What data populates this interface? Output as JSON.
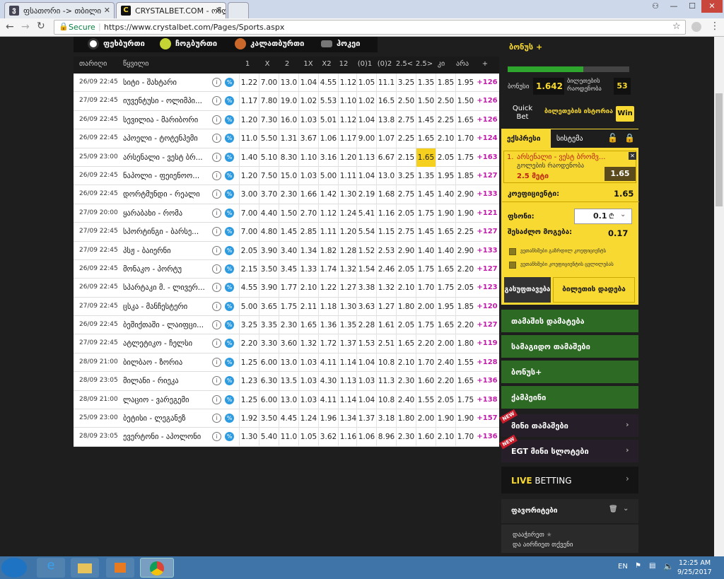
{
  "browser": {
    "tabs": [
      {
        "icon_text": "ვ",
        "label": "ფსათორი -> თბილი"
      },
      {
        "icon_text": "C",
        "label": "CRYSTALBET.COM - ონლ"
      }
    ],
    "secure_label": "Secure",
    "url": "https://www.crystalbet.com/Pages/Sports.aspx"
  },
  "sport_nav": [
    "ფეხბურთი",
    "ჩოგბურთი",
    "კალათბურთი",
    "ჰოკეი"
  ],
  "table": {
    "headers": [
      "თარიღი",
      "წყვილი",
      "1",
      "X",
      "2",
      "1X",
      "X2",
      "12",
      "(0)1",
      "(0)2",
      "2.5<",
      "2.5>",
      "კი",
      "არა",
      "+"
    ],
    "info_glyph": "i",
    "pct_glyph": "%",
    "rows": [
      {
        "date": "26/09 22:45",
        "teams": "სიტი - შახტარი",
        "odds": [
          "1.22",
          "7.00",
          "13.0",
          "1.04",
          "4.55",
          "1.12",
          "1.05",
          "11.1",
          "3.25",
          "1.35",
          "1.85",
          "1.95"
        ],
        "more": "+126"
      },
      {
        "date": "27/09 22:45",
        "teams": "იუვენტუსი - ოლიმპი...",
        "odds": [
          "1.17",
          "7.80",
          "19.0",
          "1.02",
          "5.53",
          "1.10",
          "1.02",
          "16.5",
          "2.50",
          "1.50",
          "2.50",
          "1.50"
        ],
        "more": "+126"
      },
      {
        "date": "26/09 22:45",
        "teams": "სევილია - მარიბორი",
        "odds": [
          "1.20",
          "7.30",
          "16.0",
          "1.03",
          "5.01",
          "1.12",
          "1.04",
          "13.8",
          "2.75",
          "1.45",
          "2.25",
          "1.65"
        ],
        "more": "+126"
      },
      {
        "date": "26/09 22:45",
        "teams": "აპოელი - ტოტენჰემი",
        "odds": [
          "11.0",
          "5.50",
          "1.31",
          "3.67",
          "1.06",
          "1.17",
          "9.00",
          "1.07",
          "2.25",
          "1.65",
          "2.10",
          "1.70"
        ],
        "more": "+124"
      },
      {
        "date": "25/09 23:00",
        "teams": "არსენალი - ვესტ ბრ...",
        "odds": [
          "1.40",
          "5.10",
          "8.30",
          "1.10",
          "3.16",
          "1.20",
          "1.13",
          "6.67",
          "2.15",
          "1.65",
          "2.05",
          "1.75"
        ],
        "more": "+163",
        "highlight": 9
      },
      {
        "date": "26/09 22:45",
        "teams": "ნაპოლი - ფეიენოო...",
        "odds": [
          "1.20",
          "7.50",
          "15.0",
          "1.03",
          "5.00",
          "1.11",
          "1.04",
          "13.0",
          "3.25",
          "1.35",
          "1.95",
          "1.85"
        ],
        "more": "+127"
      },
      {
        "date": "26/09 22:45",
        "teams": "დორტმუნდი - რეალი",
        "odds": [
          "3.00",
          "3.70",
          "2.30",
          "1.66",
          "1.42",
          "1.30",
          "2.19",
          "1.68",
          "2.75",
          "1.45",
          "1.40",
          "2.90"
        ],
        "more": "+133"
      },
      {
        "date": "27/09 20:00",
        "teams": "ყარაბახი - რომა",
        "odds": [
          "7.00",
          "4.40",
          "1.50",
          "2.70",
          "1.12",
          "1.24",
          "5.41",
          "1.16",
          "2.05",
          "1.75",
          "1.90",
          "1.90"
        ],
        "more": "+121"
      },
      {
        "date": "27/09 22:45",
        "teams": "სპორტინგი - ბარსე...",
        "odds": [
          "7.00",
          "4.80",
          "1.45",
          "2.85",
          "1.11",
          "1.20",
          "5.54",
          "1.15",
          "2.75",
          "1.45",
          "1.65",
          "2.25"
        ],
        "more": "+127"
      },
      {
        "date": "27/09 22:45",
        "teams": "პსჟ - ბაიერნი",
        "odds": [
          "2.05",
          "3.90",
          "3.40",
          "1.34",
          "1.82",
          "1.28",
          "1.52",
          "2.53",
          "2.90",
          "1.40",
          "1.40",
          "2.90"
        ],
        "more": "+133"
      },
      {
        "date": "26/09 22:45",
        "teams": "მონაკო - პორტუ",
        "odds": [
          "2.15",
          "3.50",
          "3.45",
          "1.33",
          "1.74",
          "1.32",
          "1.54",
          "2.46",
          "2.05",
          "1.75",
          "1.65",
          "2.20"
        ],
        "more": "+127"
      },
      {
        "date": "26/09 22:45",
        "teams": "სპარტაკი მ. - ლივერ...",
        "odds": [
          "4.55",
          "3.90",
          "1.77",
          "2.10",
          "1.22",
          "1.27",
          "3.38",
          "1.32",
          "2.10",
          "1.70",
          "1.75",
          "2.05"
        ],
        "more": "+123"
      },
      {
        "date": "27/09 22:45",
        "teams": "ცსკა - მანჩესტერი",
        "odds": [
          "5.00",
          "3.65",
          "1.75",
          "2.11",
          "1.18",
          "1.30",
          "3.63",
          "1.27",
          "1.80",
          "2.00",
          "1.95",
          "1.85"
        ],
        "more": "+120"
      },
      {
        "date": "26/09 22:45",
        "teams": "ბეშიქთაში - ლაიფცი...",
        "odds": [
          "3.25",
          "3.35",
          "2.30",
          "1.65",
          "1.36",
          "1.35",
          "2.28",
          "1.61",
          "2.05",
          "1.75",
          "1.65",
          "2.20"
        ],
        "more": "+127"
      },
      {
        "date": "27/09 22:45",
        "teams": "ატლეტიკო - ჩელსი",
        "odds": [
          "2.20",
          "3.30",
          "3.60",
          "1.32",
          "1.72",
          "1.37",
          "1.53",
          "2.51",
          "1.65",
          "2.20",
          "2.00",
          "1.80"
        ],
        "more": "+119"
      },
      {
        "date": "28/09 21:00",
        "teams": "ბილბაო - ზორია",
        "odds": [
          "1.25",
          "6.00",
          "13.0",
          "1.03",
          "4.11",
          "1.14",
          "1.04",
          "10.8",
          "2.10",
          "1.70",
          "2.40",
          "1.55"
        ],
        "more": "+128"
      },
      {
        "date": "28/09 23:05",
        "teams": "მილანი - რიეკა",
        "odds": [
          "1.23",
          "6.30",
          "13.5",
          "1.03",
          "4.30",
          "1.13",
          "1.03",
          "11.3",
          "2.30",
          "1.60",
          "2.20",
          "1.65"
        ],
        "more": "+136"
      },
      {
        "date": "28/09 21:00",
        "teams": "ლაციო - ვარეგემი",
        "odds": [
          "1.25",
          "6.00",
          "13.0",
          "1.03",
          "4.11",
          "1.14",
          "1.04",
          "10.8",
          "2.40",
          "1.55",
          "2.05",
          "1.75"
        ],
        "more": "+138"
      },
      {
        "date": "25/09 23:00",
        "teams": "ბეტისი - ლეგანეზ",
        "odds": [
          "1.92",
          "3.50",
          "4.45",
          "1.24",
          "1.96",
          "1.34",
          "1.37",
          "3.18",
          "1.80",
          "2.00",
          "1.90",
          "1.90"
        ],
        "more": "+157"
      },
      {
        "date": "28/09 23:05",
        "teams": "ევერტონი - აპოლონი",
        "odds": [
          "1.30",
          "5.40",
          "11.0",
          "1.05",
          "3.62",
          "1.16",
          "1.06",
          "8.96",
          "2.30",
          "1.60",
          "2.10",
          "1.70"
        ],
        "more": "+136"
      }
    ]
  },
  "sidebar": {
    "bonus_title": "ბონუს +",
    "bonus_progress": 0.62,
    "bonus_label": "ბონუსი",
    "bonus_value": "1.642",
    "tickets_label": "ბილეთების რაოდენობა",
    "tickets_value": "53",
    "quick_bet": "Quick Bet",
    "tickets_history": "ბილეთების ისტორია",
    "win_label": "Win",
    "tab_express": "ექსპრესი",
    "tab_system": "სისტემა",
    "slip": {
      "num": "1.",
      "match": "არსენალი - ვესტ ბრომვ...",
      "market": "გოლების რაოდენობა",
      "pick": "2.5 მეტი",
      "odd": "1.65",
      "coef_label": "კოეფიციენტი:",
      "coef_value": "1.65",
      "stake_label": "ფსონი:",
      "stake_value": "0.1",
      "win_label": "შესაძლო მოგება:",
      "win_value": "0.17",
      "check1": "ვეთანხმები გაზრდილ კოეფიციენტს",
      "check2": "ვეთანხმები კოეფიციენტის ცვლილებას",
      "clear_btn": "გასუფთავება",
      "place_btn": "ბილეთის დადება"
    },
    "menu": [
      "თამაშის დამატება",
      "სამაგიდო თამაშები",
      "ბონუს+",
      "ქამპეინი"
    ],
    "dark_menu": [
      "მინი თამაშები",
      "EGT მინი სლოტები"
    ],
    "new_badge": "NEW",
    "live": [
      "LIVE",
      " BETTING"
    ],
    "favorites": "ფავორიტები",
    "fav_hint1": "დააჭირეთ",
    "fav_hint2": "და აირჩიეთ თქვენი"
  },
  "taskbar": {
    "lang": "EN",
    "time": "12:25 AM",
    "date": "9/25/2017"
  }
}
